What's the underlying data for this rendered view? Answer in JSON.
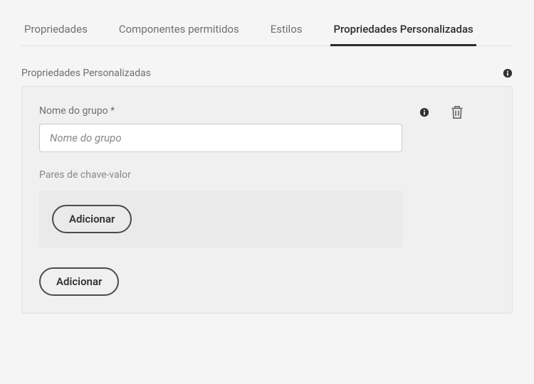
{
  "tabs": {
    "items": [
      {
        "label": "Propriedades"
      },
      {
        "label": "Componentes permitidos"
      },
      {
        "label": "Estilos"
      },
      {
        "label": "Propriedades Personalizadas"
      }
    ],
    "activeIndex": 3
  },
  "section": {
    "title": "Propriedades Personalizadas"
  },
  "group": {
    "nameLabel": "Nome do grupo *",
    "namePlaceholder": "Nome do grupo",
    "nameValue": "",
    "kvLabel": "Pares de chave-valor",
    "addInnerLabel": "Adicionar",
    "addOuterLabel": "Adicionar"
  }
}
